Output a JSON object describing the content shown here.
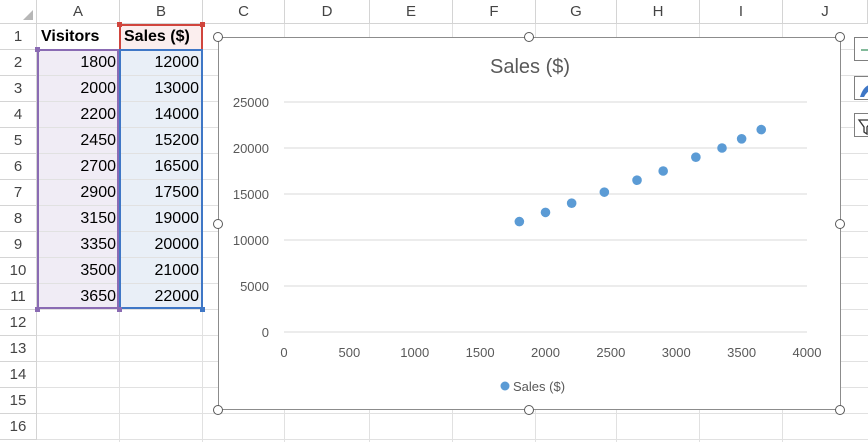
{
  "columns": [
    "A",
    "B",
    "C",
    "D",
    "E",
    "F",
    "G",
    "H",
    "I",
    "J"
  ],
  "rows": [
    "1",
    "2",
    "3",
    "4",
    "5",
    "6",
    "7",
    "8",
    "9",
    "10",
    "11",
    "12",
    "13",
    "14",
    "15",
    "16"
  ],
  "table": {
    "headers": [
      "Visitors",
      "Sales ($)"
    ],
    "visitors": [
      "1800",
      "2000",
      "2200",
      "2450",
      "2700",
      "2900",
      "3150",
      "3350",
      "3500",
      "3650"
    ],
    "sales": [
      "12000",
      "13000",
      "14000",
      "15200",
      "16500",
      "17500",
      "19000",
      "20000",
      "21000",
      "22000"
    ]
  },
  "side_buttons": [
    "chart-elements-icon",
    "chart-styles-icon",
    "chart-filters-icon"
  ],
  "colors": {
    "series": "#5b9bd5",
    "range_purple": "#8a6bb3",
    "range_blue": "#3f77c6",
    "range_red": "#d0453d"
  },
  "chart_data": {
    "type": "scatter",
    "title": "Sales ($)",
    "xlabel": "",
    "ylabel": "",
    "xlim": [
      0,
      4000
    ],
    "ylim": [
      0,
      25000
    ],
    "xticks": [
      "0",
      "500",
      "1000",
      "1500",
      "2000",
      "2500",
      "3000",
      "3500",
      "4000"
    ],
    "yticks": [
      "0",
      "5000",
      "10000",
      "15000",
      "20000",
      "25000"
    ],
    "grid": true,
    "legend": "bottom",
    "series": [
      {
        "name": "Sales ($)",
        "x": [
          1800,
          2000,
          2200,
          2450,
          2700,
          2900,
          3150,
          3350,
          3500,
          3650
        ],
        "y": [
          12000,
          13000,
          14000,
          15200,
          16500,
          17500,
          19000,
          20000,
          21000,
          22000
        ]
      }
    ]
  }
}
